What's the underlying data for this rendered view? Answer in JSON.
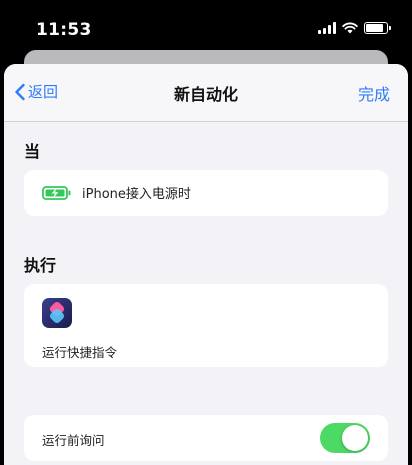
{
  "status_bar": {
    "time": "11:53"
  },
  "nav": {
    "back_label": "返回",
    "title": "新自动化",
    "done_label": "完成"
  },
  "trigger_section": {
    "title": "当",
    "condition": "iPhone接入电源时"
  },
  "action_section": {
    "title": "执行",
    "action": "运行快捷指令"
  },
  "settings": {
    "ask_before_running_label": "运行前询问",
    "ask_before_running_on": true
  },
  "colors": {
    "accent": "#2f7cf6",
    "toggle_on": "#4cd964",
    "battery_green": "#34c759",
    "background": "#f2f2f7"
  },
  "icons": [
    "signal-icon",
    "wifi-icon",
    "battery-icon",
    "chevron-left-icon",
    "battery-charging-icon",
    "shortcuts-icon"
  ]
}
